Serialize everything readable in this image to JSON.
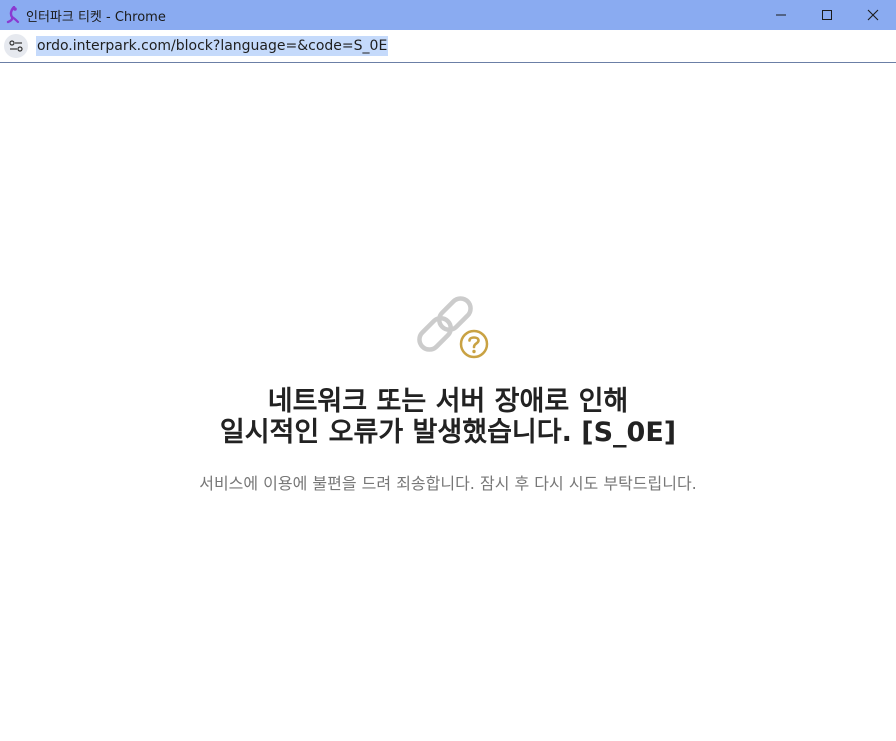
{
  "window": {
    "title": "인터파크 티켓 - Chrome",
    "icons": {
      "app": "interpark-logo-icon",
      "minimize": "minimize-icon",
      "maximize": "maximize-icon",
      "close": "close-icon"
    }
  },
  "addressbar": {
    "url": "ordo.interpark.com/block?language=&code=S_0E",
    "site_icon": "site-settings-icon"
  },
  "error": {
    "icon": "broken-link-question-icon",
    "title_line1": "네트워크 또는 서버 장애로 인해",
    "title_line2": "일시적인 오류가 발생했습니다. [S_0E]",
    "description": "서비스에 이용에 불편을 드려 죄송합니다. 잠시 후 다시 시도 부탁드립니다."
  },
  "colors": {
    "titlebar": "#8aabf1",
    "url_highlight": "#c5dafb",
    "icon_gray": "#cccccc",
    "icon_gold": "#c9a243",
    "title_text": "#222222",
    "desc_text": "#777777",
    "logo_purple": "#8a3ad0"
  }
}
